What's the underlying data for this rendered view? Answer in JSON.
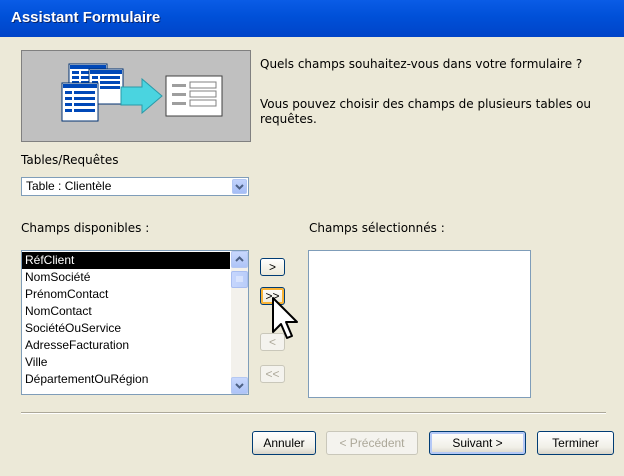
{
  "window": {
    "title": "Assistant Formulaire"
  },
  "prompt": {
    "question": "Quels champs souhaitez-vous dans votre formulaire ?",
    "hint_line1": "Vous pouvez choisir des champs de plusieurs tables ou",
    "hint_line2": "requêtes."
  },
  "tables": {
    "label": "Tables/Requêtes",
    "selected": "Table : Clientèle"
  },
  "available": {
    "label": "Champs disponibles :",
    "items": [
      "RéfClient",
      "NomSociété",
      "PrénomContact",
      "NomContact",
      "SociétéOuService",
      "AdresseFacturation",
      "Ville",
      "DépartementOuRégion"
    ]
  },
  "selected_fields": {
    "label": "Champs sélectionnés :",
    "items": []
  },
  "move": {
    "one": ">",
    "all": ">>",
    "back_one": "<",
    "back_all": "<<"
  },
  "buttons": {
    "cancel": "Annuler",
    "previous": "< Précédent",
    "next": "Suivant >",
    "finish": "Terminer"
  },
  "icons": {
    "dropdown": "chevron-down-icon",
    "arrow": "arrow-right-icon",
    "cursor": "mouse-pointer-icon"
  },
  "colors": {
    "titlebar": "#0050d8",
    "dialog": "#ece9d8",
    "selection": "#000000",
    "accent_arrow": "#4ad4e0"
  }
}
